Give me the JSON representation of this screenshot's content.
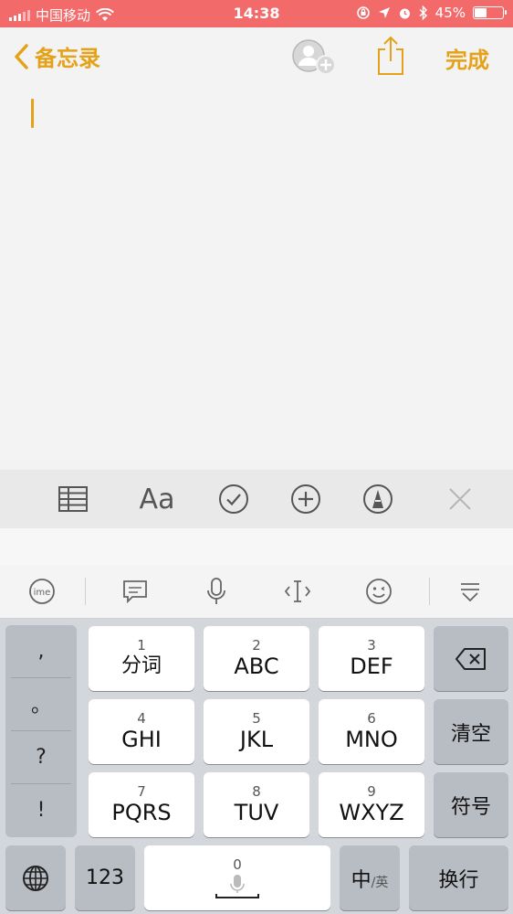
{
  "status_bar": {
    "carrier": "中国移动",
    "time": "14:38",
    "battery": "45%",
    "battery_level": 0.45
  },
  "navbar": {
    "back_label": "备忘录",
    "done_label": "完成"
  },
  "format_toolbar": {
    "text_style_label": "Aa"
  },
  "keyboard": {
    "punctuation": [
      ",",
      "。",
      "?",
      "!"
    ],
    "t9_keys": [
      {
        "num": "1",
        "label": "分词"
      },
      {
        "num": "2",
        "label": "ABC"
      },
      {
        "num": "3",
        "label": "DEF"
      },
      {
        "num": "4",
        "label": "GHI"
      },
      {
        "num": "5",
        "label": "JKL"
      },
      {
        "num": "6",
        "label": "MNO"
      },
      {
        "num": "7",
        "label": "PQRS"
      },
      {
        "num": "8",
        "label": "TUV"
      },
      {
        "num": "9",
        "label": "WXYZ"
      }
    ],
    "clear_label": "清空",
    "symbol_label": "符号",
    "numbers_label": "123",
    "space_num": "0",
    "lang_main": "中",
    "lang_sub": "/英",
    "return_label": "换行"
  },
  "colors": {
    "accent": "#e5a118",
    "status_bar": "#f26a6a"
  }
}
